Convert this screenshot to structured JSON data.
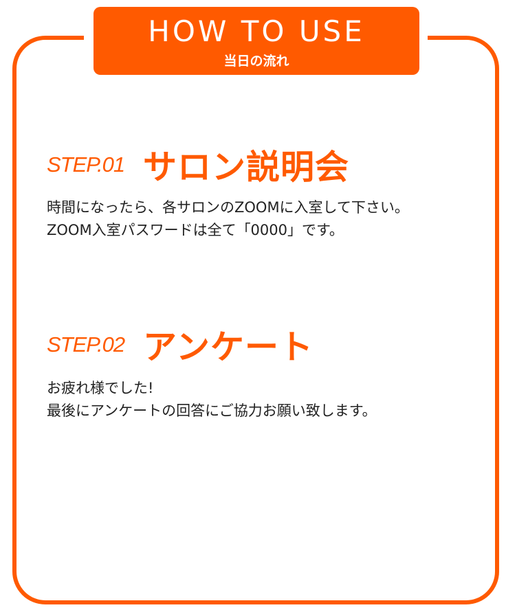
{
  "header": {
    "title": "HOW TO USE",
    "subtitle": "当日の流れ"
  },
  "steps": [
    {
      "label": "STEP.01",
      "title": "サロン説明会",
      "lines": [
        "時間になったら、各サロンのZOOMに入室して下さい。",
        "ZOOM入室パスワードは全て「0000」です。"
      ]
    },
    {
      "label": "STEP.02",
      "title": "アンケート",
      "lines": [
        "お疲れ様でした!",
        "最後にアンケートの回答にご協力お願い致します。"
      ]
    }
  ],
  "colors": {
    "accent": "#ff5a00",
    "text": "#222222",
    "background": "#ffffff"
  }
}
